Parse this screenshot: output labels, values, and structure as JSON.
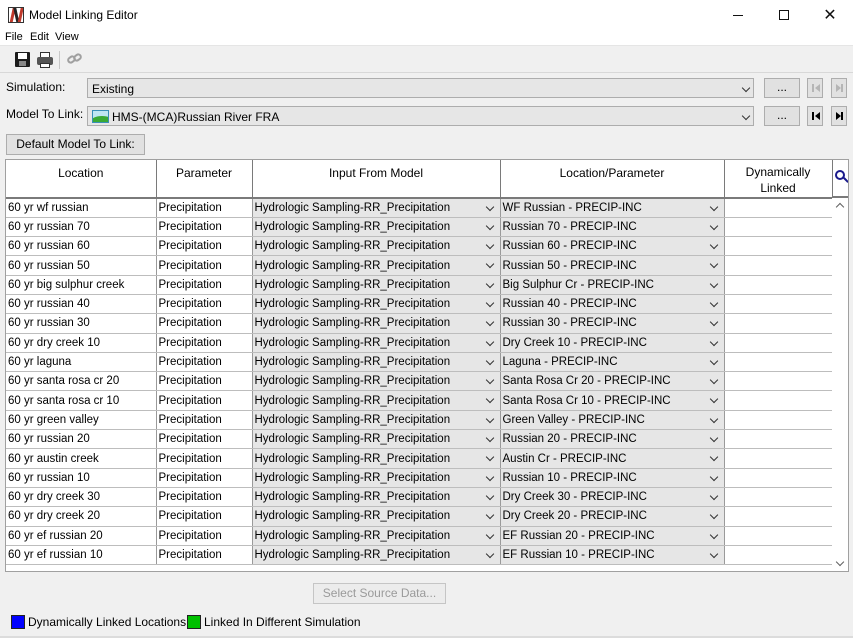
{
  "window": {
    "title": "Model Linking Editor",
    "controls": {
      "minimize": "minimize",
      "maximize": "maximize",
      "close": "✕"
    }
  },
  "menu": [
    "File",
    "Edit",
    "View"
  ],
  "toolbar": {
    "icons": [
      "save-icon",
      "print-icon",
      "link-icon"
    ]
  },
  "simulation": {
    "label": "Simulation:",
    "value": "Existing",
    "browse_label": "..."
  },
  "model_to_link": {
    "label": "Model To Link:",
    "value": "HMS-(MCA)Russian River FRA",
    "browse_label": "..."
  },
  "default_button": "Default Model To Link:",
  "table": {
    "columns": [
      "Location",
      "Parameter",
      "Input From Model",
      "Location/Parameter",
      "Dynamically Linked"
    ],
    "rows": [
      [
        "60 yr wf russian",
        "Precipitation",
        "Hydrologic Sampling-RR_Precipitation",
        "WF Russian - PRECIP-INC",
        ""
      ],
      [
        "60 yr russian 70",
        "Precipitation",
        "Hydrologic Sampling-RR_Precipitation",
        "Russian 70 - PRECIP-INC",
        ""
      ],
      [
        "60 yr russian 60",
        "Precipitation",
        "Hydrologic Sampling-RR_Precipitation",
        "Russian 60 - PRECIP-INC",
        ""
      ],
      [
        "60 yr russian 50",
        "Precipitation",
        "Hydrologic Sampling-RR_Precipitation",
        "Russian 50 - PRECIP-INC",
        ""
      ],
      [
        "60 yr big sulphur creek",
        "Precipitation",
        "Hydrologic Sampling-RR_Precipitation",
        "Big Sulphur Cr - PRECIP-INC",
        ""
      ],
      [
        "60 yr russian 40",
        "Precipitation",
        "Hydrologic Sampling-RR_Precipitation",
        "Russian 40 - PRECIP-INC",
        ""
      ],
      [
        "60 yr russian 30",
        "Precipitation",
        "Hydrologic Sampling-RR_Precipitation",
        "Russian 30 - PRECIP-INC",
        ""
      ],
      [
        "60 yr dry creek 10",
        "Precipitation",
        "Hydrologic Sampling-RR_Precipitation",
        "Dry Creek 10 - PRECIP-INC",
        ""
      ],
      [
        "60 yr laguna",
        "Precipitation",
        "Hydrologic Sampling-RR_Precipitation",
        "Laguna - PRECIP-INC",
        ""
      ],
      [
        "60 yr santa rosa cr 20",
        "Precipitation",
        "Hydrologic Sampling-RR_Precipitation",
        "Santa Rosa Cr 20 - PRECIP-INC",
        ""
      ],
      [
        "60 yr santa rosa cr 10",
        "Precipitation",
        "Hydrologic Sampling-RR_Precipitation",
        "Santa Rosa Cr 10 - PRECIP-INC",
        ""
      ],
      [
        "60 yr green valley",
        "Precipitation",
        "Hydrologic Sampling-RR_Precipitation",
        "Green Valley - PRECIP-INC",
        ""
      ],
      [
        "60 yr russian 20",
        "Precipitation",
        "Hydrologic Sampling-RR_Precipitation",
        "Russian 20 - PRECIP-INC",
        ""
      ],
      [
        "60 yr austin creek",
        "Precipitation",
        "Hydrologic Sampling-RR_Precipitation",
        "Austin Cr - PRECIP-INC",
        ""
      ],
      [
        "60 yr russian 10",
        "Precipitation",
        "Hydrologic Sampling-RR_Precipitation",
        "Russian 10 - PRECIP-INC",
        ""
      ],
      [
        "60 yr dry creek 30",
        "Precipitation",
        "Hydrologic Sampling-RR_Precipitation",
        "Dry Creek 30 - PRECIP-INC",
        ""
      ],
      [
        "60 yr dry creek 20",
        "Precipitation",
        "Hydrologic Sampling-RR_Precipitation",
        "Dry Creek 20 - PRECIP-INC",
        ""
      ],
      [
        "60 yr ef russian 20",
        "Precipitation",
        "Hydrologic Sampling-RR_Precipitation",
        "EF Russian 20 - PRECIP-INC",
        ""
      ],
      [
        "60 yr ef russian 10",
        "Precipitation",
        "Hydrologic Sampling-RR_Precipitation",
        "EF Russian 10 - PRECIP-INC",
        ""
      ]
    ]
  },
  "select_source_button": "Select Source Data...",
  "legend": [
    {
      "label": "Dynamically Linked Locations",
      "color": "#0000ff"
    },
    {
      "label": "Linked In Different Simulation",
      "color": "#00c000"
    }
  ]
}
